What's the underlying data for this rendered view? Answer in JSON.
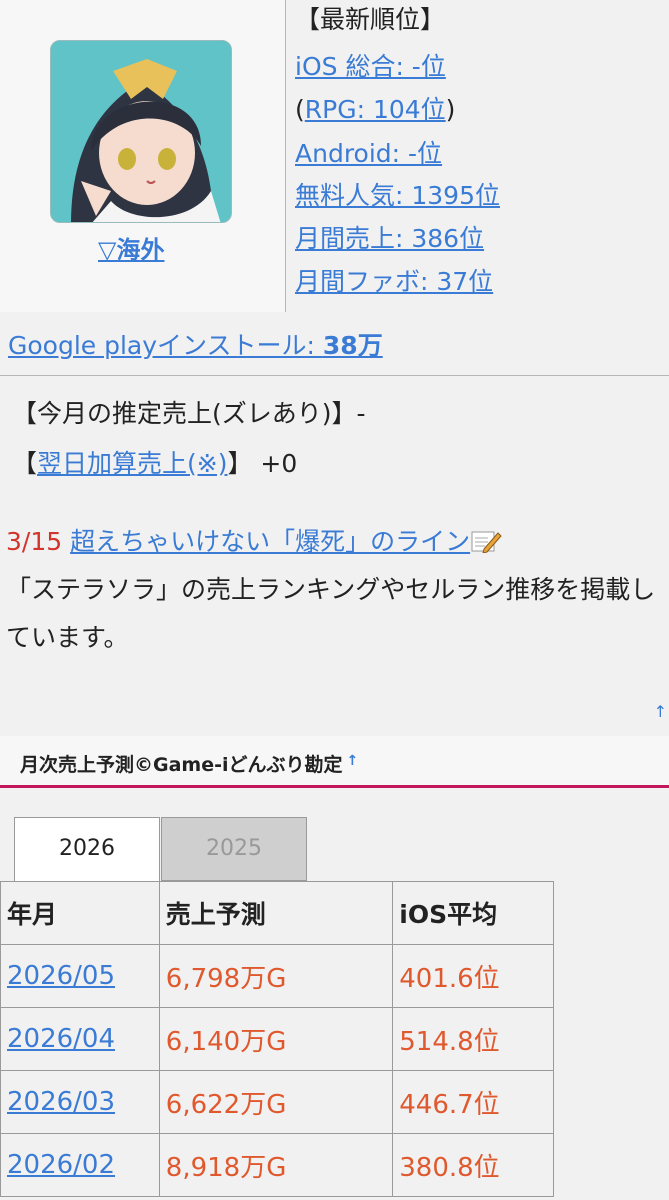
{
  "ranking": {
    "title": "【最新順位】",
    "ios_total": "iOS 総合: -位",
    "rpg_open": "(",
    "rpg": "RPG: 104位",
    "rpg_close": ")",
    "android": "Android: -位",
    "free": "無料人気: 1395位",
    "monthly_sales": "月間売上: 386位",
    "monthly_fav": "月間ファボ: 37位"
  },
  "overseas_link": "▽海外",
  "gplay": {
    "label": "Google playインストール: ",
    "value": "38万"
  },
  "sales_estimate": {
    "monthly_label": "【今月の推定売上(ズレあり)】-",
    "next_day_open": "【",
    "next_day_link": "翌日加算売上(※)",
    "next_day_rest": "】 +0"
  },
  "news": {
    "date": "3/15",
    "link": "超えちゃいけない「爆死」のライン",
    "description": "「ステラソラ」の売上ランキングやセルラン推移を掲載しています。"
  },
  "back_to_top": "↑",
  "section": {
    "title": "月次売上予測©Game-iどんぶり勘定",
    "up": "↑"
  },
  "tabs": [
    "2026",
    "2025"
  ],
  "table": {
    "headers": [
      "年月",
      "売上予測",
      "iOS平均"
    ],
    "rows": [
      {
        "month": "2026/05",
        "sales": "6,798万G",
        "ios_avg": "401.6位"
      },
      {
        "month": "2026/04",
        "sales": "6,140万G",
        "ios_avg": "514.8位"
      },
      {
        "month": "2026/03",
        "sales": "6,622万G",
        "ios_avg": "446.7位"
      },
      {
        "month": "2026/02",
        "sales": "8,918万G",
        "ios_avg": "380.8位"
      }
    ]
  },
  "colors": {
    "link": "#3a7bd5",
    "accent_red": "#d2352c",
    "value_orange": "#e0592e",
    "section_border": "#c2185b"
  }
}
